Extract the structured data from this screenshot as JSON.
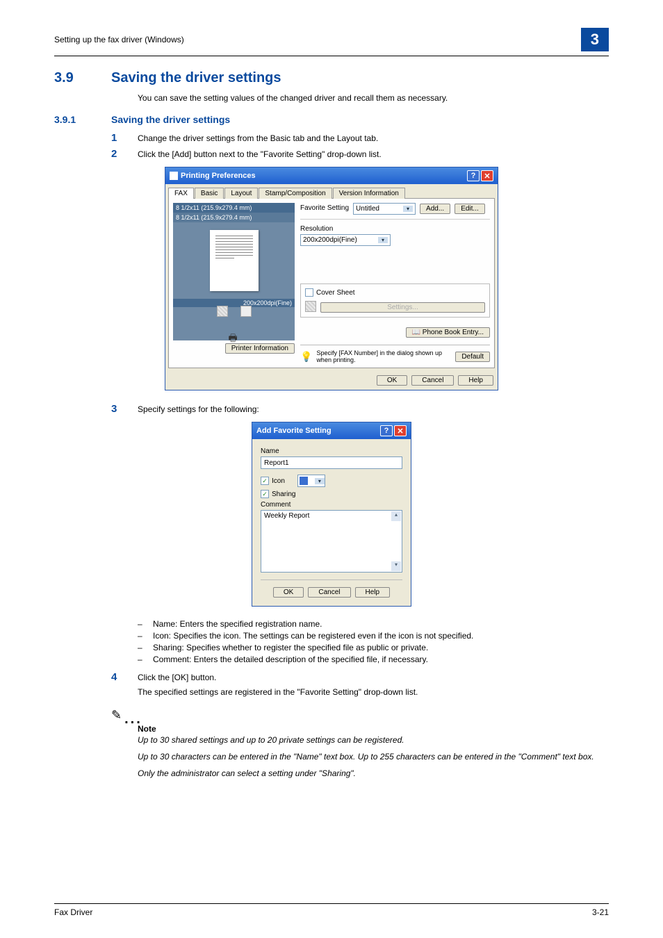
{
  "header": {
    "breadcrumb": "Setting up the fax driver (Windows)",
    "chapter": "3"
  },
  "section": {
    "num": "3.9",
    "title": "Saving the driver settings",
    "intro": "You can save the setting values of the changed driver and recall them as necessary."
  },
  "subsection": {
    "num": "3.9.1",
    "title": "Saving the driver settings"
  },
  "steps": {
    "s1": {
      "n": "1",
      "t": "Change the driver settings from the Basic tab and the Layout tab."
    },
    "s2": {
      "n": "2",
      "t": "Click the [Add] button next to the \"Favorite Setting\" drop-down list."
    },
    "s3": {
      "n": "3",
      "t": "Specify settings for the following:"
    },
    "s4": {
      "n": "4",
      "t": "Click the [OK] button."
    },
    "s4b": "The specified settings are registered in the \"Favorite Setting\" drop-down list."
  },
  "pp": {
    "title": "Printing Preferences",
    "tabs": [
      "FAX",
      "Basic",
      "Layout",
      "Stamp/Composition",
      "Version Information"
    ],
    "size1": "8 1/2x11 (215.9x279.4 mm)",
    "size2": "8 1/2x11 (215.9x279.4 mm)",
    "resbadge": "200x200dpi(Fine)",
    "printer_info": "Printer Information",
    "fav_label": "Favorite Setting",
    "fav_value": "Untitled",
    "add_btn": "Add...",
    "edit_btn": "Edit...",
    "res_label": "Resolution",
    "res_value": "200x200dpi(Fine)",
    "cover_label": "Cover Sheet",
    "cover_settings": "Settings...",
    "phonebook": "Phone Book Entry...",
    "specify": "Specify [FAX Number] in the dialog shown up when printing.",
    "default_btn": "Default",
    "ok": "OK",
    "cancel": "Cancel",
    "help": "Help"
  },
  "afs": {
    "title": "Add Favorite Setting",
    "name_label": "Name",
    "name_value": "Report1",
    "icon_label": "Icon",
    "sharing_label": "Sharing",
    "comment_label": "Comment",
    "comment_value": "Weekly Report",
    "ok": "OK",
    "cancel": "Cancel",
    "help": "Help"
  },
  "bullets": {
    "b1": "Name: Enters the specified registration name.",
    "b2": "Icon: Specifies the icon. The settings can be registered even if the icon is not specified.",
    "b3": "Sharing: Specifies whether to register the specified file as public or private.",
    "b4": "Comment: Enters the detailed description of the specified file, if necessary."
  },
  "note": {
    "label": "Note",
    "n1": "Up to 30 shared settings and up to 20 private settings can be registered.",
    "n2": "Up to 30 characters can be entered in the \"Name\" text box. Up to 255 characters can be entered in the \"Comment\" text box.",
    "n3": "Only the administrator can select a setting under \"Sharing\"."
  },
  "footer": {
    "left": "Fax Driver",
    "right": "3-21"
  }
}
